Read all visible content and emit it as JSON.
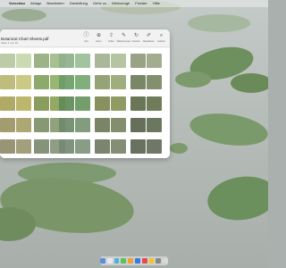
{
  "menubar": {
    "items": [
      "Vorschau",
      "Ablage",
      "Bearbeiten",
      "Darstellung",
      "Gehe zu",
      "Werkzeuge",
      "Fenster",
      "Hilfe"
    ]
  },
  "window": {
    "title": "Botanical Chart Sheets.pdf",
    "subtitle": "Seite 1 von 10",
    "toolbar": [
      {
        "label": "Info",
        "icon": "info-icon"
      },
      {
        "label": "Zoom",
        "icon": "zoom-icon"
      },
      {
        "label": "Teilen",
        "icon": "share-icon"
      },
      {
        "label": "Markierungen",
        "icon": "highlight-icon"
      },
      {
        "label": "Drehen",
        "icon": "rotate-icon"
      },
      {
        "label": "Bearbeiten",
        "icon": "markup-icon"
      },
      {
        "label": "Suchen",
        "icon": "search-icon"
      }
    ]
  },
  "swatches": {
    "rows": [
      [
        "#b9c7a0",
        "#93ad7d",
        "#8eb08a",
        "#a3b18f",
        "#8f9a7d"
      ],
      [
        "#b8b770",
        "#84a25f",
        "#6c9c68",
        "#8b9c6a",
        "#6f7d5a"
      ],
      [
        "#a9a35a",
        "#7f9550",
        "#5f8a57",
        "#7d8750",
        "#5d6a47"
      ],
      [
        "#9a9462",
        "#7c8f68",
        "#6e8a6a",
        "#6f7a5a",
        "#58634c"
      ],
      [
        "#8f8c6a",
        "#7b8a70",
        "#748a73",
        "#707a62",
        "#5c6553"
      ]
    ]
  },
  "dock": {
    "colors": [
      "#5a8fd8",
      "#e8e8e8",
      "#4cb0e6",
      "#5cc05c",
      "#f0a030",
      "#3a7ae0",
      "#e64a4a",
      "#f5c518",
      "#888888",
      "#d8d8d8"
    ]
  }
}
